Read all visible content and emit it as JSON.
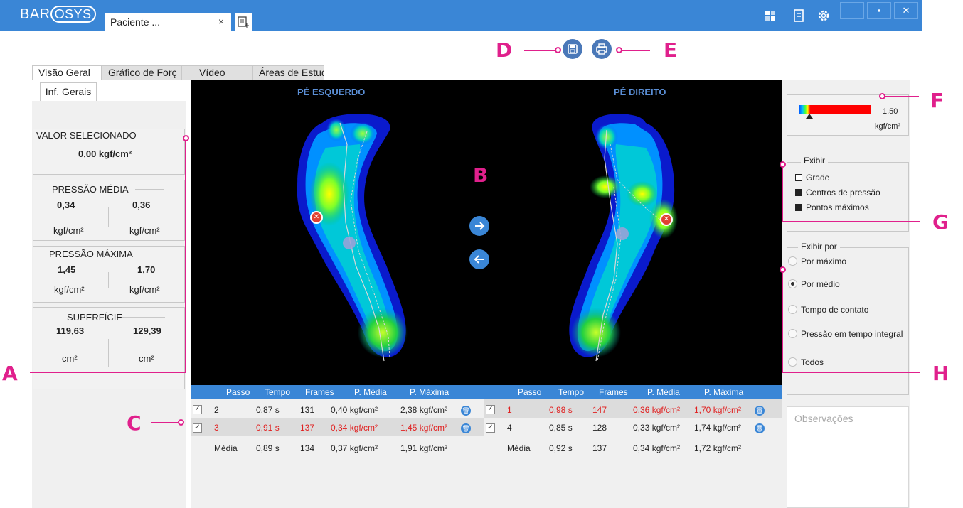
{
  "app": {
    "brand_left": "BAR",
    "brand_os": "OSYS"
  },
  "tab": {
    "label": "Paciente ...",
    "close": "×"
  },
  "callouts": [
    "A",
    "B",
    "C",
    "D",
    "E",
    "F",
    "G",
    "H"
  ],
  "main_tabs": [
    "Visão Geral",
    "Gráfico de Forç",
    "Vídeo",
    "Áreas de Estudo"
  ],
  "sub_tab": "Inf. Gerais",
  "selected_value": {
    "title": "VALOR SELECIONADO",
    "value": "0,00 kgf/cm²"
  },
  "pressao_media": {
    "title": "PRESSÃO MÉDIA",
    "left": "0,34",
    "right": "0,36",
    "unit": "kgf/cm²"
  },
  "pressao_maxima": {
    "title": "PRESSÃO MÁXIMA",
    "left": "1,45",
    "right": "1,70",
    "unit": "kgf/cm²"
  },
  "superficie": {
    "title": "SUPERFÍCIE",
    "left": "119,63",
    "right": "129,39",
    "unit": "cm²"
  },
  "foot_titles": {
    "left": "PÉ ESQUERDO",
    "right": "PÉ DIREITO"
  },
  "table_headers": [
    "Passo",
    "Tempo",
    "Frames",
    "P. Média",
    "P. Máxima"
  ],
  "left_rows": [
    {
      "checked": "✓",
      "passo": "2",
      "tempo": "0,87 s",
      "frames": "131",
      "media": "0,40 kgf/cm²",
      "maxima": "2,38 kgf/cm²",
      "highlight": false
    },
    {
      "checked": "✓",
      "passo": "3",
      "tempo": "0,91 s",
      "frames": "137",
      "media": "0,34 kgf/cm²",
      "maxima": "1,45 kgf/cm²",
      "highlight": true
    }
  ],
  "left_avg": {
    "label": "Média",
    "tempo": "0,89 s",
    "frames": "134",
    "media": "0,37 kgf/cm²",
    "maxima": "1,91 kgf/cm²"
  },
  "right_rows": [
    {
      "checked": "✓",
      "passo": "1",
      "tempo": "0,98 s",
      "frames": "147",
      "media": "0,36 kgf/cm²",
      "maxima": "1,70 kgf/cm²",
      "highlight": true
    },
    {
      "checked": "✓",
      "passo": "4",
      "tempo": "0,85 s",
      "frames": "128",
      "media": "0,33 kgf/cm²",
      "maxima": "1,74 kgf/cm²",
      "highlight": false
    }
  ],
  "right_avg": {
    "label": "Média",
    "tempo": "0,92 s",
    "frames": "137",
    "media": "0,34 kgf/cm²",
    "maxima": "1,72 kgf/cm²"
  },
  "scale": {
    "value": "1,50",
    "unit": "kgf/cm²"
  },
  "exibir": {
    "title": "Exibir",
    "options": [
      {
        "label": "Grade",
        "checked": false
      },
      {
        "label": "Centros de pressão",
        "checked": true
      },
      {
        "label": "Pontos máximos",
        "checked": true
      }
    ]
  },
  "exibir_por": {
    "title": "Exibir por",
    "options": [
      "Por máximo",
      "Por médio",
      "Tempo de contato",
      "Pressão em tempo integral",
      "Todos"
    ],
    "selected": "Por médio"
  },
  "observacoes": {
    "placeholder": "Observações"
  },
  "colors": {
    "titlebar": "#3a86d6",
    "callout": "#e0208c",
    "highlight_text": "#e02020"
  }
}
